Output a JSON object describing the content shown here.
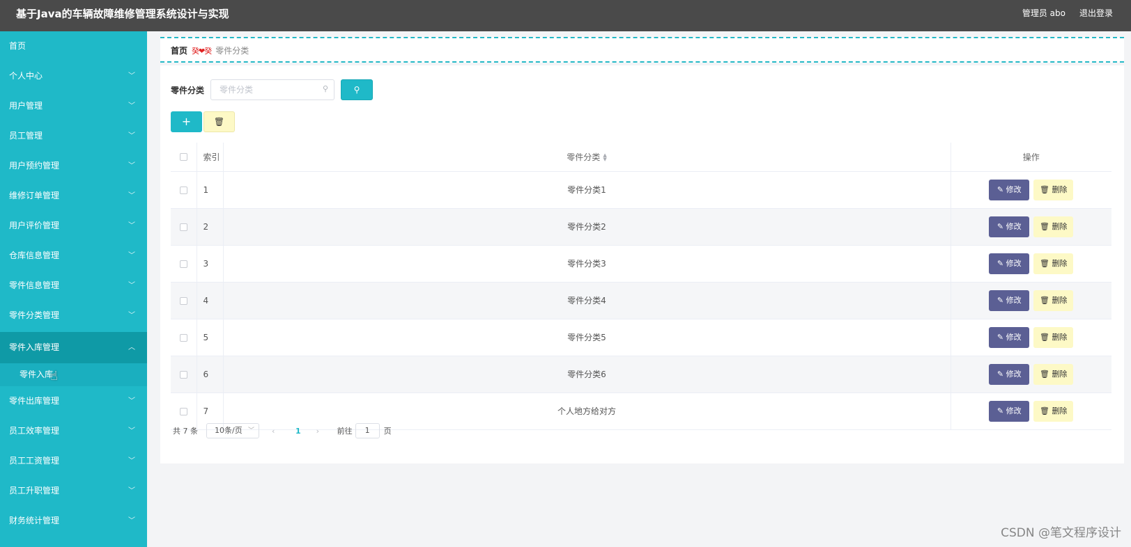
{
  "header": {
    "title": "基于Java的车辆故障维修管理系统设计与实现",
    "user_label": "管理员 abo",
    "logout_label": "退出登录"
  },
  "sidebar": {
    "items": [
      {
        "label": "首页"
      },
      {
        "label": "个人中心"
      },
      {
        "label": "用户管理"
      },
      {
        "label": "员工管理"
      },
      {
        "label": "用户预约管理"
      },
      {
        "label": "维修订单管理"
      },
      {
        "label": "用户评价管理"
      },
      {
        "label": "仓库信息管理"
      },
      {
        "label": "零件信息管理"
      },
      {
        "label": "零件分类管理"
      },
      {
        "label": "零件入库管理"
      },
      {
        "label": "零件出库管理"
      },
      {
        "label": "员工效率管理"
      },
      {
        "label": "员工工资管理"
      },
      {
        "label": "员工升职管理"
      },
      {
        "label": "财务统计管理"
      }
    ],
    "sub_item_label": "零件入库"
  },
  "breadcrumb": {
    "home": "首页",
    "separator": "癸❤癸",
    "current": "零件分类"
  },
  "search": {
    "label": "零件分类",
    "placeholder": "零件分类"
  },
  "table": {
    "headers": {
      "index": "索引",
      "name": "零件分类",
      "ops": "操作"
    },
    "edit_label": "修改",
    "delete_label": "删除",
    "rows": [
      {
        "index": "1",
        "name": "零件分类1"
      },
      {
        "index": "2",
        "name": "零件分类2"
      },
      {
        "index": "3",
        "name": "零件分类3"
      },
      {
        "index": "4",
        "name": "零件分类4"
      },
      {
        "index": "5",
        "name": "零件分类5"
      },
      {
        "index": "6",
        "name": "零件分类6"
      },
      {
        "index": "7",
        "name": "个人地方给对方"
      }
    ]
  },
  "pagination": {
    "total": "共 7 条",
    "page_size": "10条/页",
    "current_page": "1",
    "goto_prefix": "前往",
    "goto_value": "1",
    "goto_suffix": "页"
  },
  "watermark": "CSDN @笔文程序设计",
  "colors": {
    "accent": "#1fb9c8",
    "sidebar_active": "#0f9aa6",
    "edit_button": "#5b5f94",
    "delete_button": "#fdf9c6",
    "header_bg": "#4a4a4a"
  }
}
